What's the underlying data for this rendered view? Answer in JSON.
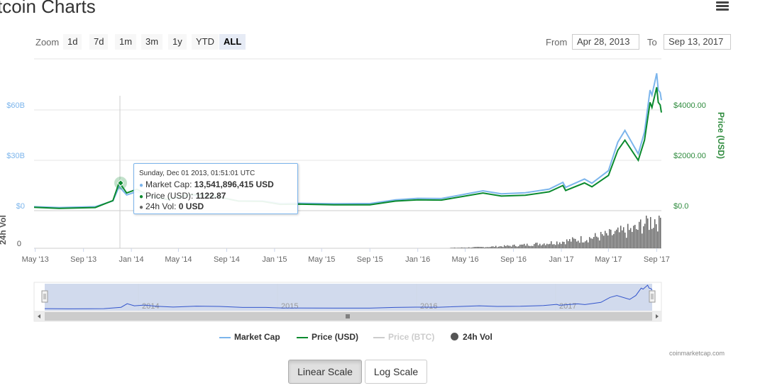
{
  "header": {
    "title": "tcoin Charts",
    "menu_icon": "hamburger-icon"
  },
  "zoom": {
    "label": "Zoom",
    "buttons": [
      "1d",
      "7d",
      "1m",
      "3m",
      "1y",
      "YTD",
      "ALL"
    ],
    "active": "ALL"
  },
  "range": {
    "from_label": "From",
    "from_value": "Apr 28, 2013",
    "to_label": "To",
    "to_value": "Sep 13, 2017"
  },
  "tooltip": {
    "header": "Sunday, Dec 01 2013, 01:51:01 UTC",
    "rows": [
      {
        "label": "Market Cap: ",
        "value": "13,541,896,415 USD",
        "color": "#7cb5ec"
      },
      {
        "label": "Price (USD): ",
        "value": "1122.87",
        "color": "#0a8a2e"
      },
      {
        "label": "24h Vol: ",
        "value": "0 USD",
        "color": "#666666"
      }
    ]
  },
  "legend": [
    {
      "label": "Market Cap",
      "color": "#7cb5ec",
      "type": "line",
      "enabled": true
    },
    {
      "label": "Price (USD)",
      "color": "#0a8a2e",
      "type": "line",
      "enabled": true
    },
    {
      "label": "Price (BTC)",
      "color": "#cccccc",
      "type": "line",
      "enabled": false
    },
    {
      "label": "24h Vol",
      "color": "#555555",
      "type": "dot",
      "enabled": true
    }
  ],
  "credits": "coinmarketcap.com",
  "scale_buttons": {
    "linear": "Linear Scale",
    "log": "Log Scale",
    "active": "linear"
  },
  "colors": {
    "market_cap": "#7cb5ec",
    "price_usd": "#0a8a2e",
    "volume": "#666666",
    "navigator_fill": "rgba(102,133,194,0.3)",
    "navigator_line": "#3355cc"
  },
  "chart_data": {
    "type": "line",
    "title": "",
    "x_ticks": [
      "May '13",
      "Sep '13",
      "Jan '14",
      "May '14",
      "Sep '14",
      "Jan '15",
      "May '15",
      "Sep '15",
      "Jan '16",
      "May '16",
      "Sep '16",
      "Jan '17",
      "May '17",
      "Sep '17"
    ],
    "left_axis": {
      "label": "",
      "ticks": [
        "$0",
        "$30B",
        "$60B"
      ],
      "range": [
        0,
        60000000000
      ]
    },
    "right_axis": {
      "label": "Price (USD)",
      "ticks": [
        "$0.0",
        "$2000.00",
        "$4000.00"
      ],
      "range": [
        0,
        4000
      ]
    },
    "volume_axis": {
      "label": "24h Vol",
      "ticks": [
        "0"
      ]
    },
    "navigator_ticks": [
      "2014",
      "2015",
      "2016",
      "2017"
    ],
    "grid": true,
    "legend_position": "bottom",
    "series": [
      {
        "name": "Price (USD)",
        "x": [
          "2013-04-28",
          "2013-07-01",
          "2013-10-01",
          "2013-11-15",
          "2013-12-01",
          "2013-12-20",
          "2014-01-15",
          "2014-02-15",
          "2014-04-01",
          "2014-06-01",
          "2014-08-01",
          "2014-10-01",
          "2014-12-01",
          "2015-01-15",
          "2015-03-01",
          "2015-06-01",
          "2015-09-01",
          "2015-11-05",
          "2016-01-01",
          "2016-03-01",
          "2016-06-15",
          "2016-08-01",
          "2016-10-01",
          "2016-12-01",
          "2017-01-05",
          "2017-01-12",
          "2017-03-01",
          "2017-03-20",
          "2017-05-01",
          "2017-05-25",
          "2017-06-12",
          "2017-07-16",
          "2017-08-01",
          "2017-08-15",
          "2017-08-20",
          "2017-09-01",
          "2017-09-05",
          "2017-09-10",
          "2017-09-13"
        ],
        "values": [
          135,
          90,
          125,
          400,
          1122.87,
          700,
          850,
          600,
          450,
          640,
          580,
          380,
          370,
          250,
          260,
          230,
          230,
          380,
          430,
          420,
          700,
          580,
          610,
          750,
          1000,
          800,
          1100,
          950,
          1400,
          2400,
          2800,
          2000,
          2800,
          4300,
          4100,
          4900,
          4300,
          4200,
          3900
        ]
      },
      {
        "name": "Market Cap",
        "x": [
          "2013-04-28",
          "2013-07-01",
          "2013-10-01",
          "2013-11-15",
          "2013-12-01",
          "2013-12-20",
          "2014-01-15",
          "2014-02-15",
          "2014-04-01",
          "2014-06-01",
          "2014-08-01",
          "2014-10-01",
          "2014-12-01",
          "2015-01-15",
          "2015-03-01",
          "2015-06-01",
          "2015-09-01",
          "2015-11-05",
          "2016-01-01",
          "2016-03-01",
          "2016-06-15",
          "2016-08-01",
          "2016-10-01",
          "2016-12-01",
          "2017-01-05",
          "2017-01-12",
          "2017-03-01",
          "2017-03-20",
          "2017-05-01",
          "2017-05-25",
          "2017-06-12",
          "2017-07-16",
          "2017-08-01",
          "2017-08-15",
          "2017-08-20",
          "2017-09-01",
          "2017-09-05",
          "2017-09-10",
          "2017-09-13"
        ],
        "values": [
          1500000000,
          1000000000,
          1500000000,
          5000000000,
          13541896415,
          8500000000,
          10500000000,
          7500000000,
          5700000000,
          8200000000,
          7500000000,
          5000000000,
          5000000000,
          3500000000,
          3600000000,
          3300000000,
          3400000000,
          5600000000,
          6500000000,
          6400000000,
          11000000000,
          9200000000,
          9800000000,
          12000000000,
          16000000000,
          13000000000,
          18000000000,
          15500000000,
          23000000000,
          40000000000,
          47000000000,
          33000000000,
          46000000000,
          71000000000,
          68000000000,
          81000000000,
          71000000000,
          69500000000,
          65000000000
        ]
      }
    ]
  }
}
